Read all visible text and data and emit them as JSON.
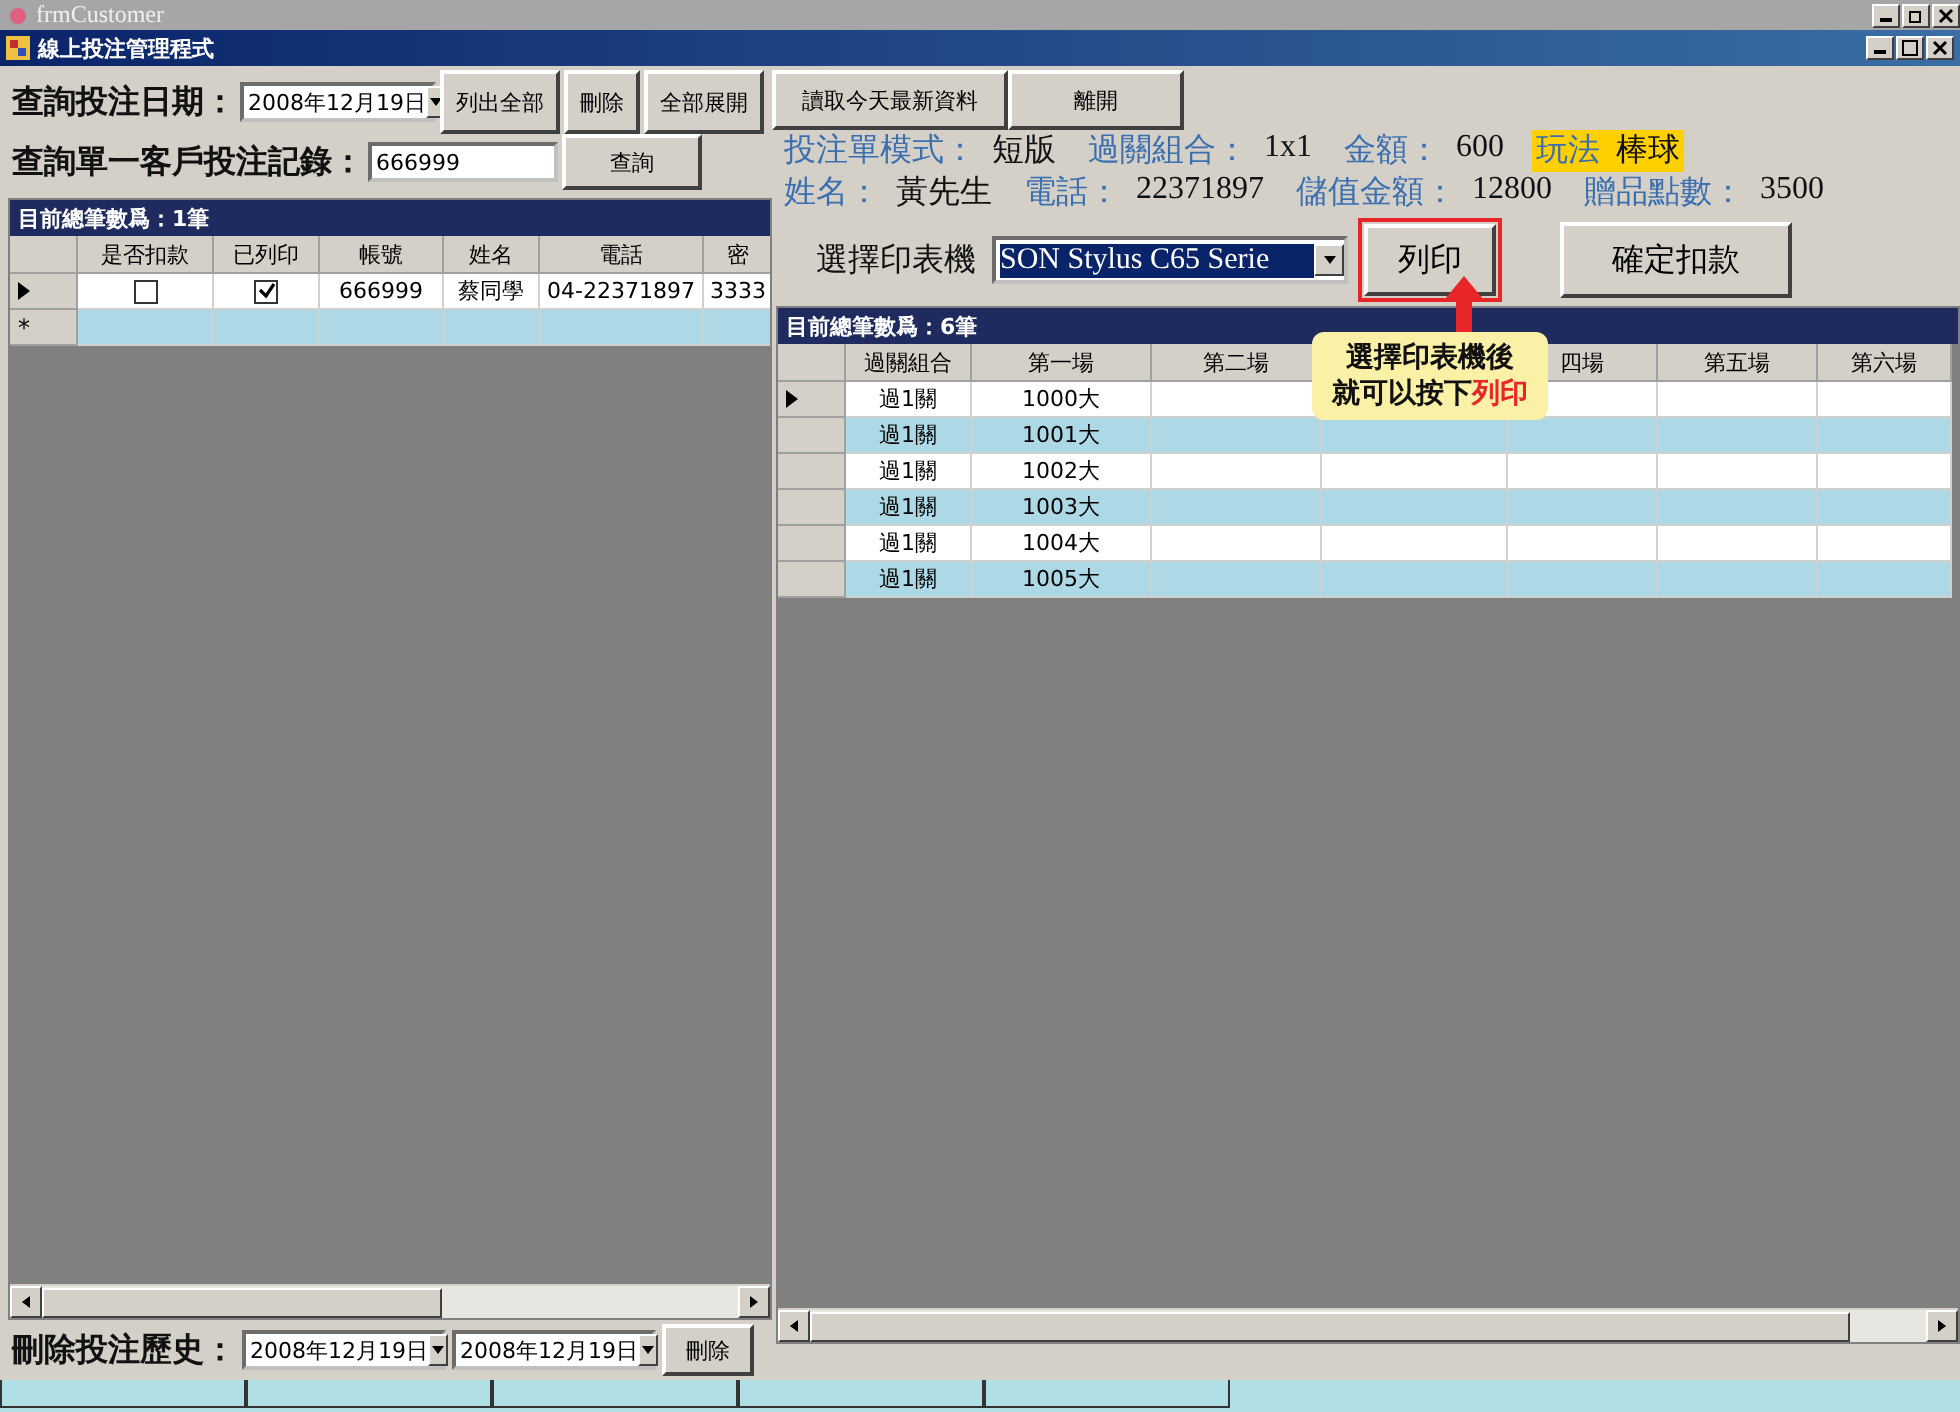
{
  "outer_window": {
    "title": "frmCustomer"
  },
  "window": {
    "title": "線上投注管理程式"
  },
  "query": {
    "date_label": "查詢投注日期：",
    "date_value": "2008年12月19日",
    "buttons": [
      "列出全部",
      "刪除",
      "全部展開"
    ],
    "customer_label": "查詢單一客戶投注記錄：",
    "customer_value": "666999",
    "search_button": "查詢"
  },
  "left_grid": {
    "caption": "目前總筆數爲：1筆",
    "columns": [
      "是否扣款",
      "已列印",
      "帳號",
      "姓名",
      "電話",
      "密"
    ],
    "rows": [
      {
        "current": true,
        "deducted": false,
        "printed": true,
        "cells": [
          "",
          "",
          "666999",
          "蔡同學",
          "04-22371897",
          "3333"
        ]
      }
    ],
    "new_row_marker": "*"
  },
  "delete_history": {
    "label": "刪除投注歷史：",
    "from": "2008年12月19日",
    "to": "2008年12月19日",
    "button": "刪除"
  },
  "right_buttons": [
    "讀取今天最新資料",
    "離開"
  ],
  "info_lines": [
    [
      {
        "label": "投注單模式：",
        "value": "短版",
        "highlighted": false
      },
      {
        "label": "過關組合：",
        "value": "1x1",
        "highlighted": false
      },
      {
        "label": "金額：",
        "value": "600",
        "highlighted": false
      },
      {
        "label": "玩法",
        "value": "棒球",
        "highlighted": true
      }
    ],
    [
      {
        "label": "姓名：",
        "value": "黃先生",
        "highlighted": false
      },
      {
        "label": "電話：",
        "value": "22371897",
        "highlighted": false
      },
      {
        "label": "儲值金額：",
        "value": "12800",
        "highlighted": false
      },
      {
        "label": "贈品點數：",
        "value": "3500",
        "highlighted": false
      }
    ]
  ],
  "printer": {
    "label": "選擇印表機",
    "value": "SON Stylus C65 Serie",
    "print_button": "列印",
    "print_highlighted": true,
    "confirm_button": "確定扣款"
  },
  "right_grid": {
    "caption": "目前總筆數爲：6筆",
    "columns": [
      {
        "label": "過關組合"
      },
      {
        "label": "第一場"
      },
      {
        "label": "第二場"
      },
      {},
      {
        "label": "四場"
      },
      {
        "label": "第五場"
      },
      {
        "label": "第六場"
      }
    ],
    "rows": [
      {
        "current": true,
        "cells": [
          "過1關",
          "1000大"
        ]
      },
      {
        "current": false,
        "cells": [
          "過1關",
          "1001大"
        ]
      },
      {
        "current": false,
        "cells": [
          "過1關",
          "1002大"
        ]
      },
      {
        "current": false,
        "cells": [
          "過1關",
          "1003大"
        ]
      },
      {
        "current": false,
        "cells": [
          "過1關",
          "1004大"
        ]
      },
      {
        "current": false,
        "cells": [
          "過1關",
          "1005大"
        ]
      }
    ]
  },
  "callout": {
    "line_1": "選擇印表機後",
    "line_2": "就可以按下",
    "emphasis": "列印"
  }
}
